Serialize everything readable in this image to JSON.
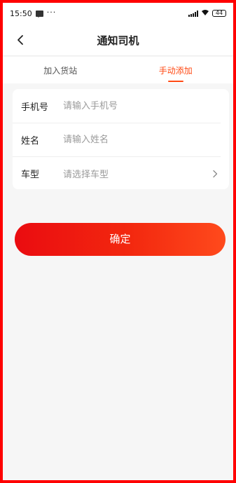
{
  "status_bar": {
    "time": "15:50",
    "more": "···",
    "battery": "44"
  },
  "header": {
    "title": "通知司机"
  },
  "tabs": [
    {
      "label": "加入货站",
      "active": false
    },
    {
      "label": "手动添加",
      "active": true
    }
  ],
  "form": {
    "phone": {
      "label": "手机号",
      "placeholder": "请输入手机号"
    },
    "name": {
      "label": "姓名",
      "placeholder": "请输入姓名"
    },
    "vehicle_type": {
      "label": "车型",
      "placeholder": "请选择车型"
    }
  },
  "confirm_button": {
    "label": "确定"
  },
  "colors": {
    "accent": "#ff4a14",
    "button_start": "#ea0c10",
    "button_end": "#ff4a1c",
    "frame_border": "#ff0000",
    "background": "#f6f6f6"
  },
  "icons": {
    "back": "chevron-left-icon",
    "select_arrow": "chevron-right-icon",
    "message": "message-icon",
    "signal": "signal-icon",
    "wifi": "wifi-icon",
    "battery": "battery-icon"
  }
}
